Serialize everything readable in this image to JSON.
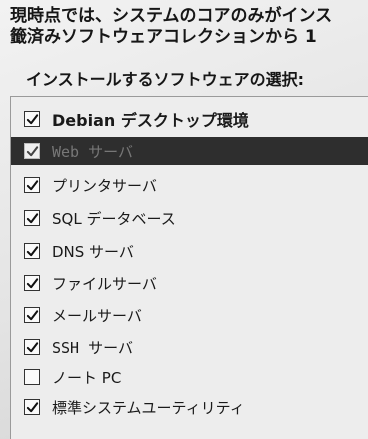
{
  "intro": {
    "line1": "現時点では、システムのコアのみがインス",
    "line2": "籤済みソフトウェアコレクションから 1"
  },
  "prompt": "インストールするソフトウェアの選択:",
  "tasks": [
    {
      "label": "Debian デスクトップ環境",
      "checked": true
    },
    {
      "label": "Web サーバ",
      "checked": true,
      "selected": true
    },
    {
      "label": "プリンタサーバ",
      "checked": true
    },
    {
      "label": "SQL データベース",
      "checked": true
    },
    {
      "label": "DNS サーバ",
      "checked": true
    },
    {
      "label": "ファイルサーバ",
      "checked": true
    },
    {
      "label": "メールサーバ",
      "checked": true
    },
    {
      "label": "SSH サーバ",
      "checked": true
    },
    {
      "label": "ノート PC",
      "checked": false
    },
    {
      "label": "標準システムユーティリティ",
      "checked": true
    }
  ],
  "icons": {
    "checked": "checkmark-icon",
    "unchecked": "empty-checkbox"
  }
}
